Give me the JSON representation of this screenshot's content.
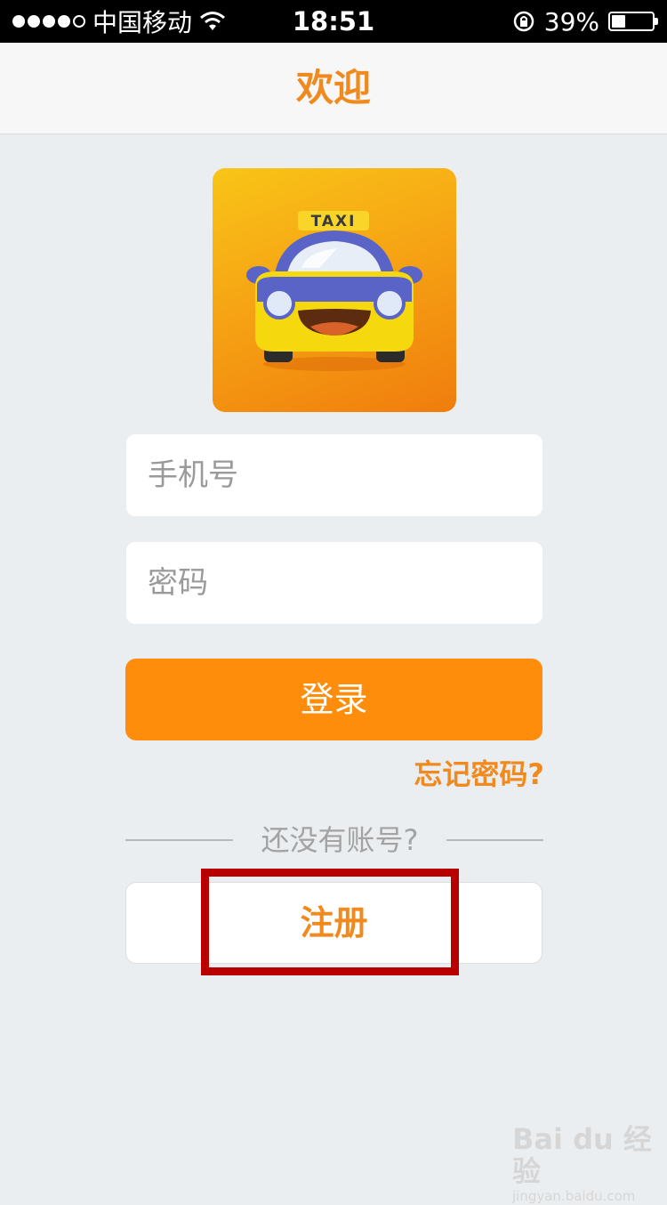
{
  "status_bar": {
    "carrier": "中国移动",
    "time": "18:51",
    "battery_percent": "39%",
    "battery_level": 0.39,
    "icons": [
      "signal-dots",
      "wifi-icon",
      "rotation-lock-icon",
      "battery-icon"
    ]
  },
  "nav": {
    "title": "欢迎"
  },
  "logo": {
    "label": "TAXI"
  },
  "form": {
    "phone_placeholder": "手机号",
    "password_placeholder": "密码",
    "login_label": "登录",
    "forgot_label": "忘记密码?"
  },
  "signup": {
    "prompt": "还没有账号?",
    "register_label": "注册"
  },
  "watermark": {
    "main": "Bai du 经验",
    "sub": "jingyan.baidu.com"
  },
  "colors": {
    "accent": "#f0891e",
    "button": "#fd8d0a",
    "highlight": "#b80000",
    "background": "#ebeef0"
  }
}
